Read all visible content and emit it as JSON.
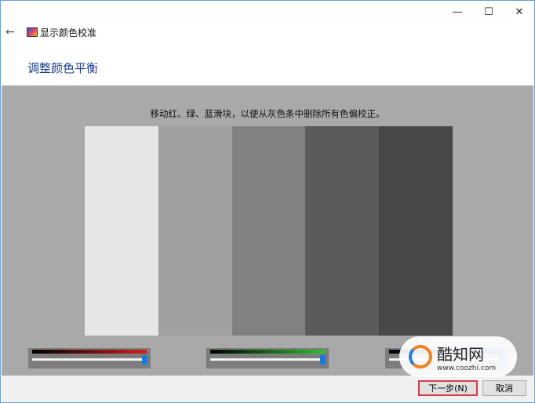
{
  "window": {
    "minimize": "—",
    "maximize": "☐",
    "close": "✕",
    "back": "←",
    "title": "显示颜色校准"
  },
  "heading": "调整颜色平衡",
  "instruction": "移动红、绿、蓝滑块，以便从灰色条中删除所有色偏校正。",
  "gray_bars": [
    "#e6e6e6",
    "#a0a0a0",
    "#818181",
    "#5b5b5b",
    "#484848"
  ],
  "sliders": [
    {
      "channel": "red",
      "value": 1.0,
      "color": "#d02020"
    },
    {
      "channel": "green",
      "value": 1.0,
      "color": "#30c030"
    },
    {
      "channel": "blue",
      "value": 1.0,
      "color": "#2050e0"
    }
  ],
  "buttons": {
    "next": "下一步(N)",
    "cancel": "取消"
  },
  "watermark": {
    "name": "酷知网",
    "url": "www.coozhi.com"
  }
}
